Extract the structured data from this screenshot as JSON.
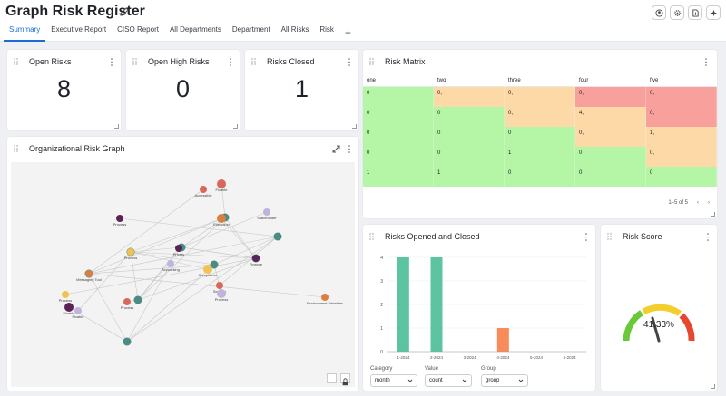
{
  "header": {
    "title": "Graph Risk Register",
    "tabs": [
      "Summary",
      "Executive Report",
      "CISO Report",
      "All Departments",
      "Department",
      "All Risks",
      "Risk"
    ],
    "active_tab": "Summary",
    "add_tab": "+"
  },
  "kpis": {
    "open_risks": {
      "title": "Open Risks",
      "value": "8"
    },
    "open_high_risks": {
      "title": "Open High Risks",
      "value": "0"
    },
    "risks_closed": {
      "title": "Risks Closed",
      "value": "1"
    }
  },
  "matrix": {
    "title": "Risk Matrix",
    "columns": [
      "one",
      "two",
      "three",
      "four",
      "five"
    ],
    "rows": [
      [
        {
          "v": "0",
          "c": "g"
        },
        {
          "v": "0,",
          "c": "o"
        },
        {
          "v": "0,",
          "c": "o"
        },
        {
          "v": "0,",
          "c": "r"
        },
        {
          "v": "0,",
          "c": "r"
        }
      ],
      [
        {
          "v": "0",
          "c": "g"
        },
        {
          "v": "0",
          "c": "g"
        },
        {
          "v": "0,",
          "c": "o"
        },
        {
          "v": "4,",
          "c": "o"
        },
        {
          "v": "0,",
          "c": "r"
        }
      ],
      [
        {
          "v": "0",
          "c": "g"
        },
        {
          "v": "0",
          "c": "g"
        },
        {
          "v": "0",
          "c": "g"
        },
        {
          "v": "0,",
          "c": "o"
        },
        {
          "v": "1,",
          "c": "o"
        }
      ],
      [
        {
          "v": "0",
          "c": "g"
        },
        {
          "v": "0",
          "c": "g"
        },
        {
          "v": "1",
          "c": "g"
        },
        {
          "v": "0",
          "c": "g"
        },
        {
          "v": "0,",
          "c": "o"
        }
      ],
      [
        {
          "v": "1",
          "c": "g"
        },
        {
          "v": "1",
          "c": "g"
        },
        {
          "v": "0",
          "c": "g"
        },
        {
          "v": "0",
          "c": "g"
        },
        {
          "v": "0",
          "c": "g"
        }
      ]
    ],
    "pagination": "1–5 of 5"
  },
  "graph": {
    "title": "Organizational Risk Graph",
    "node_labels": [
      "Fixable",
      "Process",
      "Stakeholder",
      "Process",
      "Execution",
      "Accessible",
      "Priority",
      "Accounting",
      "Compliance",
      "Messaging Tool",
      "Security",
      "Finance",
      "Process",
      "Process",
      "Environment Variables",
      "Process",
      "Fixable",
      "Fixable"
    ]
  },
  "opened_closed": {
    "title": "Risks Opened and Closed",
    "category_label": "Category",
    "category_value": "month",
    "value_label": "Value",
    "value_value": "count",
    "group_label": "Group",
    "group_value": "group"
  },
  "chart_data": {
    "type": "bar",
    "categories": [
      "1-2024",
      "2-2024",
      "3-2024",
      "4-2024",
      "5-2024",
      "6-2024"
    ],
    "series": [
      {
        "values": [
          4,
          4,
          0,
          0,
          0,
          0
        ],
        "color": "#5cc4a0"
      },
      {
        "values": [
          0,
          0,
          0,
          1,
          0,
          0
        ],
        "color": "#f78c5a"
      }
    ],
    "ylim": [
      0,
      4
    ],
    "yticks": [
      "0",
      "1",
      "2",
      "3",
      "4"
    ],
    "grid": true
  },
  "risk_score": {
    "title": "Risk Score",
    "value": "41.33%",
    "fraction": 0.4133
  },
  "colors": {
    "accent": "#1a6dd6",
    "green": "#b5f5a6",
    "orange": "#fcd9a6",
    "red": "#f8a09c"
  }
}
